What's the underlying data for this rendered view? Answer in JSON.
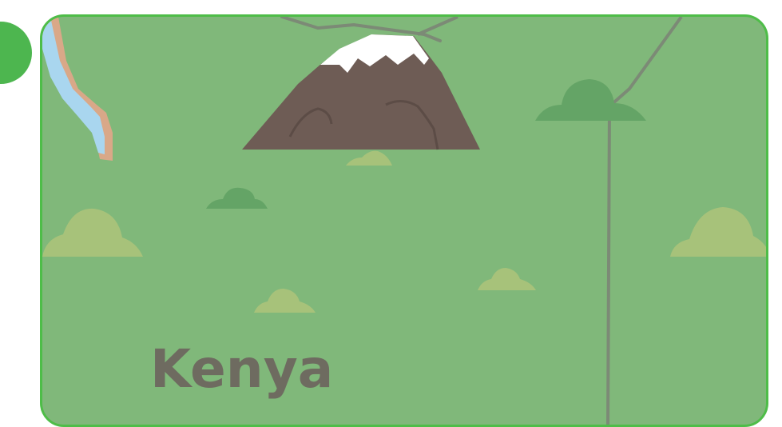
{
  "card": {
    "country": "Kenya"
  },
  "colors": {
    "card_background": "#80b87a",
    "card_border": "#4ebd48",
    "badge": "#4db64f",
    "mountain": "#6e5c55",
    "snow": "#ffffff",
    "road": "#7c8a76",
    "lake": "#a9d6ef",
    "shore": "#d9a888",
    "bush_dark": "#64a466",
    "bush_light": "#a7c27a",
    "label": "#6e6b60"
  },
  "icons": {
    "mountain": "mountain-icon",
    "lake": "lake-icon"
  }
}
